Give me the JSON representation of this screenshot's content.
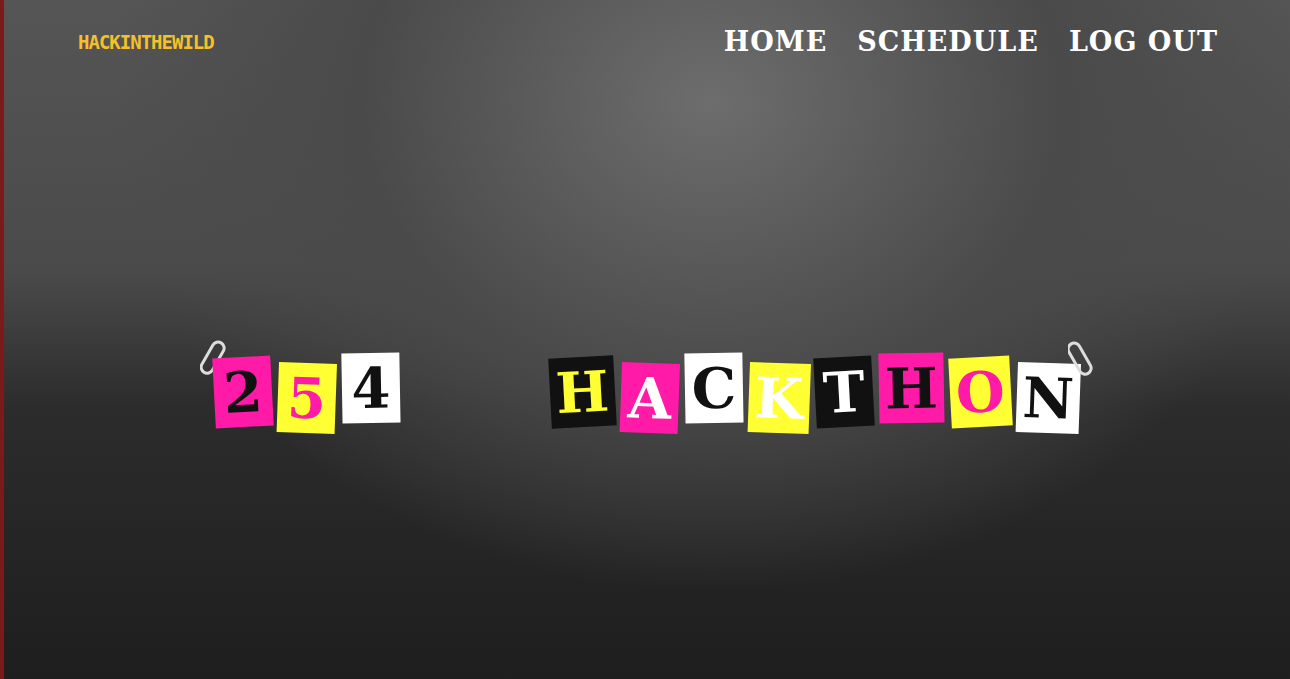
{
  "header": {
    "logo": "HACKINTHEWILD",
    "nav": [
      {
        "label": "HOME"
      },
      {
        "label": "SCHEDULE"
      },
      {
        "label": "LOG OUT"
      }
    ]
  },
  "hero": {
    "words": [
      {
        "tiles": [
          {
            "char": "2",
            "color": "#ff1aa8",
            "ink": "#111111"
          },
          {
            "char": "5",
            "color": "#ffff33",
            "ink": "#ff1aa8"
          },
          {
            "char": "4",
            "color": "#ffffff",
            "ink": "#111111"
          }
        ]
      },
      {
        "tiles": [
          {
            "char": "H",
            "color": "#111111",
            "ink": "#ffff33"
          },
          {
            "char": "A",
            "color": "#ff1aa8",
            "ink": "#ffffff"
          },
          {
            "char": "C",
            "color": "#ffffff",
            "ink": "#111111"
          },
          {
            "char": "K",
            "color": "#ffff33",
            "ink": "#ffffff"
          },
          {
            "char": "T",
            "color": "#111111",
            "ink": "#ffffff"
          },
          {
            "char": "H",
            "color": "#ff1aa8",
            "ink": "#111111"
          },
          {
            "char": "O",
            "color": "#ffff33",
            "ink": "#ff1aa8"
          },
          {
            "char": "N",
            "color": "#ffffff",
            "ink": "#111111"
          }
        ]
      }
    ]
  }
}
